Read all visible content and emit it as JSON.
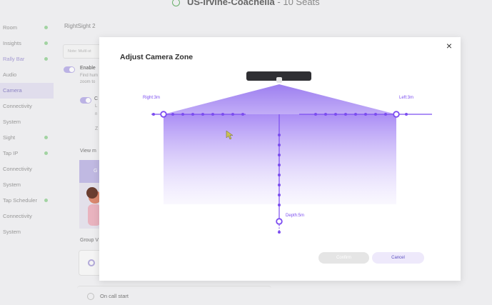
{
  "header": {
    "title": "US-Irvine-Coachella",
    "seats": "10 Seats"
  },
  "sidebar": {
    "items": [
      {
        "label": "Room",
        "dot": true
      },
      {
        "label": "Insights",
        "dot": true
      },
      {
        "label": "Rally Bar",
        "dot": true,
        "selected": true
      },
      {
        "label": "Audio",
        "dot": false
      },
      {
        "label": "Camera",
        "dot": false,
        "active": true
      },
      {
        "label": "Connectivity",
        "dot": false
      },
      {
        "label": "System",
        "dot": false
      },
      {
        "label": "Sight",
        "dot": true
      },
      {
        "label": "Tap IP",
        "dot": true
      },
      {
        "label": "Connectivity",
        "dot": false
      },
      {
        "label": "System",
        "dot": false
      },
      {
        "label": "Tap Scheduler",
        "dot": true
      },
      {
        "label": "Connectivity",
        "dot": false
      },
      {
        "label": "System",
        "dot": false
      }
    ]
  },
  "background": {
    "panel_title": "RightSight 2",
    "input_placeholder": "Note: MultI-st",
    "enable_label": "Enable",
    "enable_sub1": "Find hum",
    "enable_sub2": "zoom to",
    "c_label": "C",
    "l_label": "L",
    "n_label": "n",
    "z_label": "Z",
    "view_mode": "View m",
    "group_label": "Group V",
    "card_letter": "G",
    "on_call_start": "On call start"
  },
  "modal": {
    "title": "Adjust Camera Zone",
    "close_label": "×",
    "right_label": "Right:3m",
    "left_label": "Left:3m",
    "depth_label": "Depth:5m",
    "confirm_label": "Confirm",
    "cancel_label": "Cancel",
    "accent_color": "#7c4df0",
    "zone": {
      "right_m": 3,
      "left_m": 3,
      "depth_m": 5
    }
  }
}
